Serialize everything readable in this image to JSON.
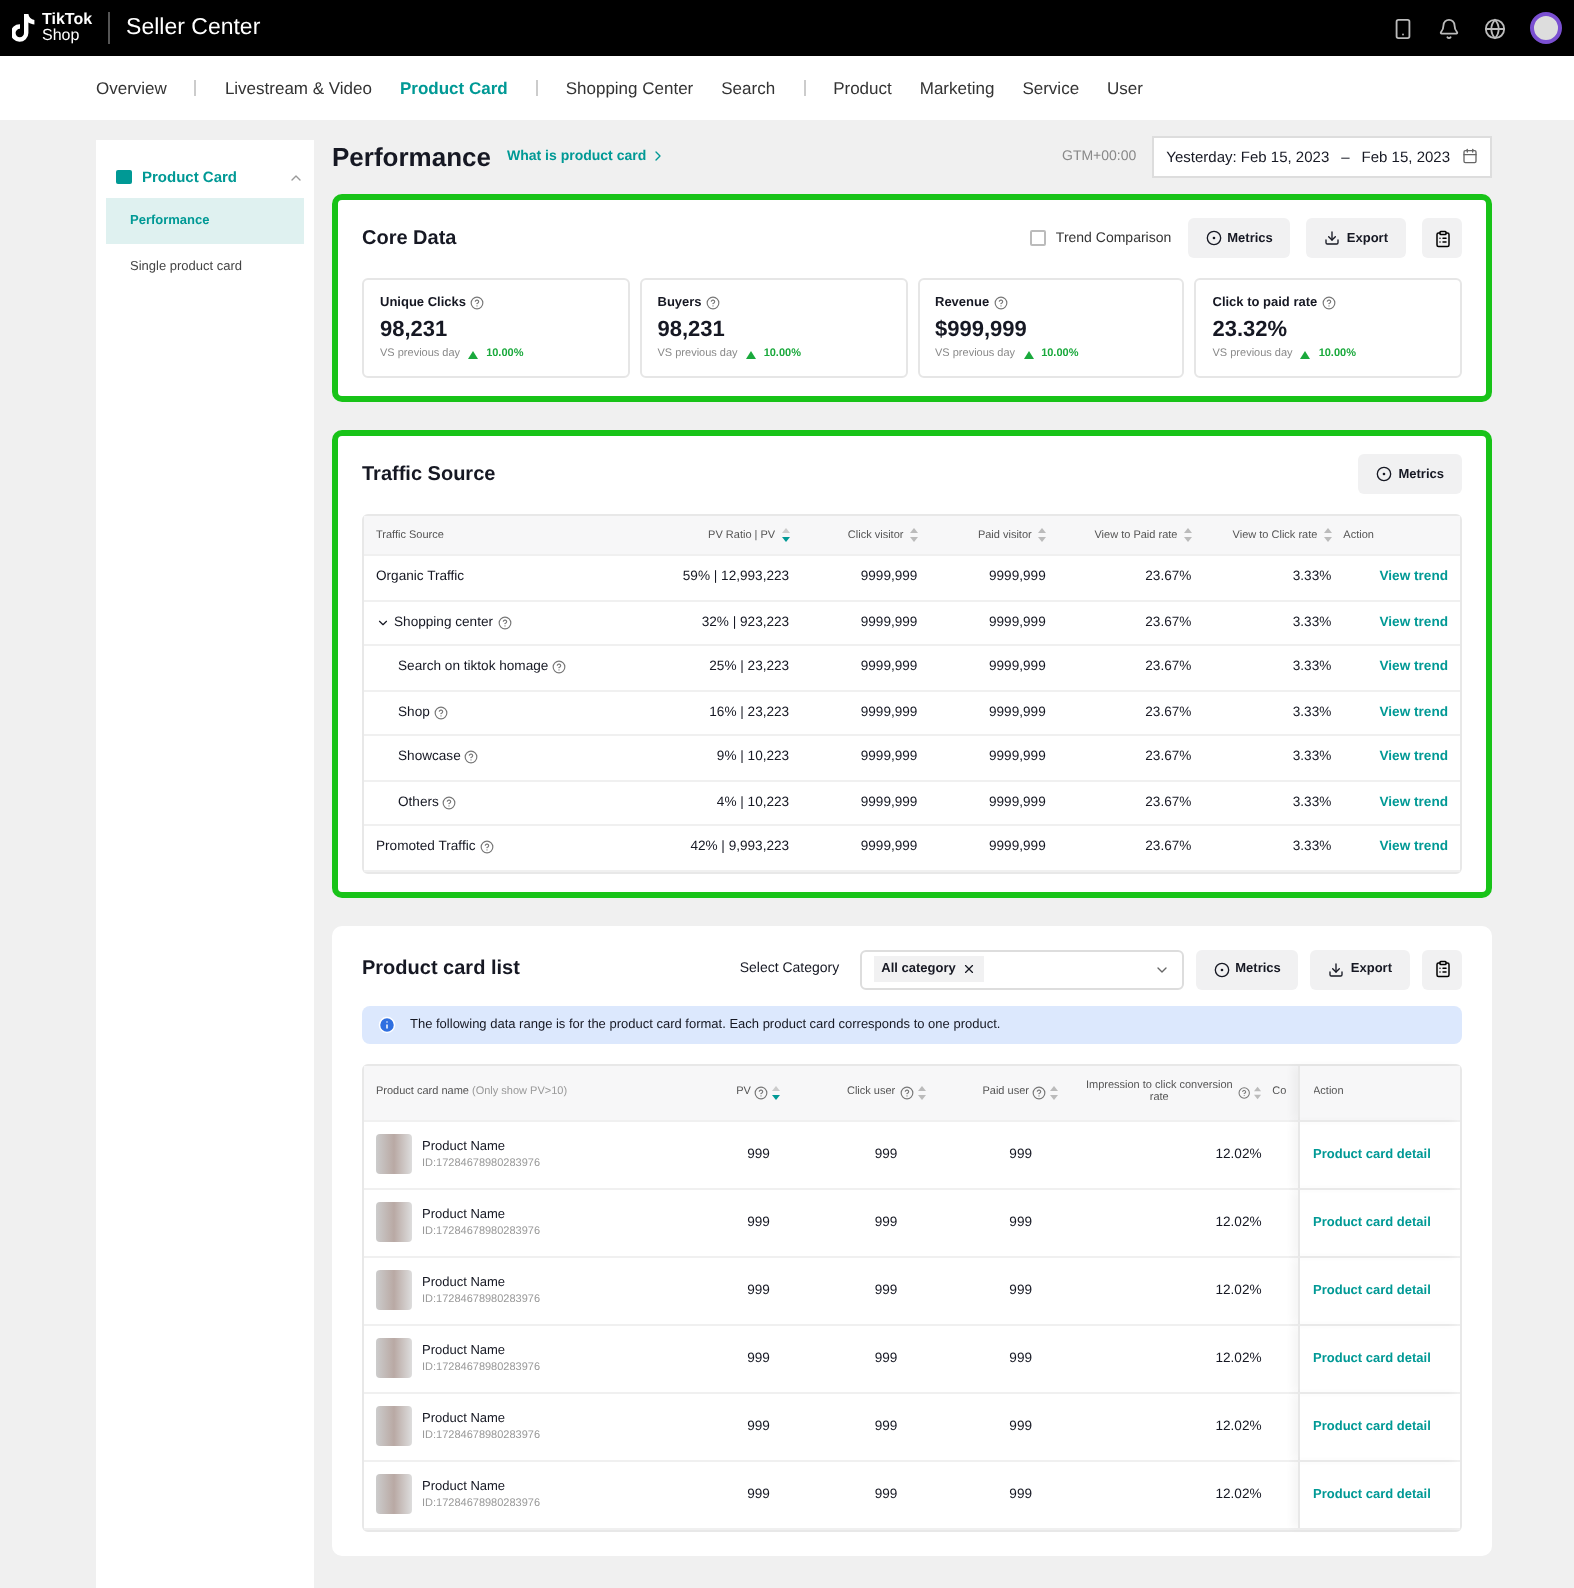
{
  "topbar": {
    "logo_line1": "TikTok",
    "logo_line2": "Shop",
    "title": "Seller Center"
  },
  "nav": [
    {
      "label": "Overview",
      "selected": false,
      "divider_after": true
    },
    {
      "label": "Livestream & Video",
      "selected": false,
      "divider_after": false
    },
    {
      "label": "Product Card",
      "selected": true,
      "divider_after": true
    },
    {
      "label": "Shopping Center",
      "selected": false,
      "divider_after": false
    },
    {
      "label": "Search",
      "selected": false,
      "divider_after": true
    },
    {
      "label": "Product",
      "selected": false,
      "divider_after": false
    },
    {
      "label": "Marketing",
      "selected": false,
      "divider_after": false
    },
    {
      "label": "Service",
      "selected": false,
      "divider_after": false
    },
    {
      "label": "User",
      "selected": false,
      "divider_after": false
    }
  ],
  "sidebar": {
    "group": {
      "label": "Product Card",
      "expanded": true
    },
    "items": [
      {
        "label": "Performance",
        "selected": true
      },
      {
        "label": "Single product card",
        "selected": false
      }
    ]
  },
  "header": {
    "title": "Performance",
    "link": "What is product card",
    "timezone": "GTM+00:00",
    "date_start": "Yesterday: Feb 15, 2023",
    "date_separator": "–",
    "date_end": "Feb 15, 2023"
  },
  "core_data": {
    "highlighted": true,
    "title": "Core Data",
    "trend_comparison": {
      "label": "Trend Comparison",
      "checked": false
    },
    "metrics_button": "Metrics",
    "export_button": "Export",
    "metrics": [
      {
        "label": "Unique Clicks",
        "value": "98,231",
        "compare_label": "VS previous day",
        "change": "10.00%"
      },
      {
        "label": "Buyers",
        "value": "98,231",
        "compare_label": "VS previous day",
        "change": "10.00%"
      },
      {
        "label": "Revenue",
        "value": "$999,999",
        "compare_label": "VS previous day",
        "change": "10.00%"
      },
      {
        "label": "Click to paid rate",
        "value": "23.32%",
        "compare_label": "VS previous day",
        "change": "10.00%"
      }
    ]
  },
  "traffic_source": {
    "highlighted": true,
    "title": "Traffic Source",
    "metrics_button": "Metrics",
    "columns": [
      {
        "label": "Traffic Source",
        "sortable": false
      },
      {
        "label": "PV Ratio | PV",
        "sortable": true,
        "sorted": true
      },
      {
        "label": "Click visitor",
        "sortable": true,
        "sorted": false
      },
      {
        "label": "Paid visitor",
        "sortable": true,
        "sorted": false
      },
      {
        "label": "View to Paid rate",
        "sortable": true,
        "sorted": false
      },
      {
        "label": "View to Click rate",
        "sortable": true,
        "sorted": false
      },
      {
        "label": "Action",
        "sortable": false
      }
    ],
    "rows": [
      {
        "source": "Organic Traffic",
        "help": false,
        "pv": "59% | 12,993,223",
        "click_visitor": "9999,999",
        "paid_visitor": "9999,999",
        "view_to_paid": "23.67%",
        "view_to_click": "3.33%",
        "action": "View trend"
      },
      {
        "source": "Shopping center",
        "help": true,
        "expanded": true,
        "pv": "32% | 923,223",
        "click_visitor": "9999,999",
        "paid_visitor": "9999,999",
        "view_to_paid": "23.67%",
        "view_to_click": "3.33%",
        "action": "View trend",
        "children": [
          {
            "source": "Search on tiktok homage",
            "help": true,
            "pv": "25% | 23,223",
            "click_visitor": "9999,999",
            "paid_visitor": "9999,999",
            "view_to_paid": "23.67%",
            "view_to_click": "3.33%",
            "action": "View trend"
          },
          {
            "source": "Shop",
            "help": true,
            "pv": "16% | 23,223",
            "click_visitor": "9999,999",
            "paid_visitor": "9999,999",
            "view_to_paid": "23.67%",
            "view_to_click": "3.33%",
            "action": "View trend"
          },
          {
            "source": "Showcase",
            "help": true,
            "pv": "9% | 10,223",
            "click_visitor": "9999,999",
            "paid_visitor": "9999,999",
            "view_to_paid": "23.67%",
            "view_to_click": "3.33%",
            "action": "View trend"
          },
          {
            "source": "Others",
            "help": true,
            "pv": "4% | 10,223",
            "click_visitor": "9999,999",
            "paid_visitor": "9999,999",
            "view_to_paid": "23.67%",
            "view_to_click": "3.33%",
            "action": "View trend"
          }
        ]
      },
      {
        "source": "Promoted Traffic",
        "help": true,
        "pv": "42% | 9,993,223",
        "click_visitor": "9999,999",
        "paid_visitor": "9999,999",
        "view_to_paid": "23.67%",
        "view_to_click": "3.33%",
        "action": "View trend"
      }
    ]
  },
  "product_list": {
    "title": "Product card list",
    "category_label": "Select Category",
    "category_tag": "All category",
    "metrics_button": "Metrics",
    "export_button": "Export",
    "notice": "The following data range is for the product card format. Each product card corresponds to one product.",
    "columns": [
      {
        "label": "Product card name",
        "note": "(Only show PV>10)",
        "help": false,
        "sortable": false
      },
      {
        "label": "PV",
        "help": true,
        "sortable": true,
        "sorted": true
      },
      {
        "label": "Click user",
        "help": true,
        "sortable": true,
        "sorted": false
      },
      {
        "label": "Paid user",
        "help": true,
        "sortable": true,
        "sorted": false
      },
      {
        "label": "Impression to click conversion rate",
        "help": true,
        "sortable": true,
        "sorted": false
      },
      {
        "label": "Co",
        "help": false,
        "sortable": false
      },
      {
        "label": "Action",
        "help": false,
        "sortable": false
      }
    ],
    "rows": [
      {
        "name": "Product Name",
        "id": "ID:17284678980283976",
        "pv": "999",
        "click_user": "999",
        "paid_user": "999",
        "conversion_rate": "12.02%",
        "action": "Product card detail"
      },
      {
        "name": "Product Name",
        "id": "ID:17284678980283976",
        "pv": "999",
        "click_user": "999",
        "paid_user": "999",
        "conversion_rate": "12.02%",
        "action": "Product card detail"
      },
      {
        "name": "Product Name",
        "id": "ID:17284678980283976",
        "pv": "999",
        "click_user": "999",
        "paid_user": "999",
        "conversion_rate": "12.02%",
        "action": "Product card detail"
      },
      {
        "name": "Product Name",
        "id": "ID:17284678980283976",
        "pv": "999",
        "click_user": "999",
        "paid_user": "999",
        "conversion_rate": "12.02%",
        "action": "Product card detail"
      },
      {
        "name": "Product Name",
        "id": "ID:17284678980283976",
        "pv": "999",
        "click_user": "999",
        "paid_user": "999",
        "conversion_rate": "12.02%",
        "action": "Product card detail"
      },
      {
        "name": "Product Name",
        "id": "ID:17284678980283976",
        "pv": "999",
        "click_user": "999",
        "paid_user": "999",
        "conversion_rate": "12.02%",
        "action": "Product card detail"
      }
    ]
  }
}
